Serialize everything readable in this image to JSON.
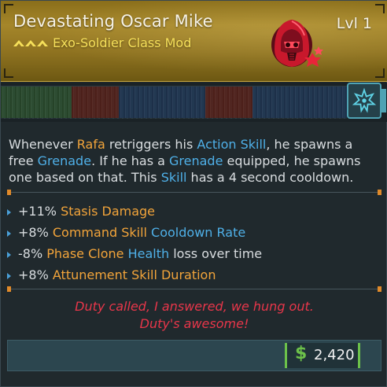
{
  "item": {
    "name": "Devastating Oscar Mike",
    "type": "Exo-Soldier Class Mod",
    "level": "Lvl 1",
    "rarity_color": "#f6e05a",
    "header_color": "#a5862a",
    "class_icon": "red-hooded-helmet-icon",
    "manufacturer_icon": "cyan-star-emblem-icon"
  },
  "description": {
    "parts": [
      {
        "text": "Whenever ",
        "hl": ""
      },
      {
        "text": "Rafa",
        "hl": "orange"
      },
      {
        "text": " retriggers his ",
        "hl": ""
      },
      {
        "text": "Action Skill",
        "hl": "blue"
      },
      {
        "text": ", he spawns a free ",
        "hl": ""
      },
      {
        "text": "Grenade",
        "hl": "blue"
      },
      {
        "text": ". If he has a ",
        "hl": ""
      },
      {
        "text": "Grenade",
        "hl": "blue"
      },
      {
        "text": " equipped, he spawns one based on that. This ",
        "hl": ""
      },
      {
        "text": "Skill",
        "hl": "blue"
      },
      {
        "text": " has a 4 second cooldown.",
        "hl": ""
      }
    ]
  },
  "stats": [
    [
      {
        "text": "+11% ",
        "hl": ""
      },
      {
        "text": "Stasis Damage",
        "hl": "orange"
      }
    ],
    [
      {
        "text": "+8% ",
        "hl": ""
      },
      {
        "text": "Command Skill",
        "hl": "orange"
      },
      {
        "text": " ",
        "hl": ""
      },
      {
        "text": "Cooldown Rate",
        "hl": "blue"
      }
    ],
    [
      {
        "text": "-8% ",
        "hl": ""
      },
      {
        "text": "Phase Clone",
        "hl": "orange"
      },
      {
        "text": " ",
        "hl": ""
      },
      {
        "text": "Health",
        "hl": "blue"
      },
      {
        "text": " loss over time",
        "hl": ""
      }
    ],
    [
      {
        "text": "+8% ",
        "hl": ""
      },
      {
        "text": "Attunement Skill Duration",
        "hl": "orange"
      }
    ]
  ],
  "flavor": {
    "line1": "Duty called, I answered, we hung out.",
    "line2": "Duty's awesome!"
  },
  "price": {
    "symbol": "$",
    "value": "2,420",
    "color": "#6cc14a"
  },
  "colors": {
    "orange": "#f2a43a",
    "blue": "#4fb0e8",
    "flavor": "#e8364a"
  }
}
